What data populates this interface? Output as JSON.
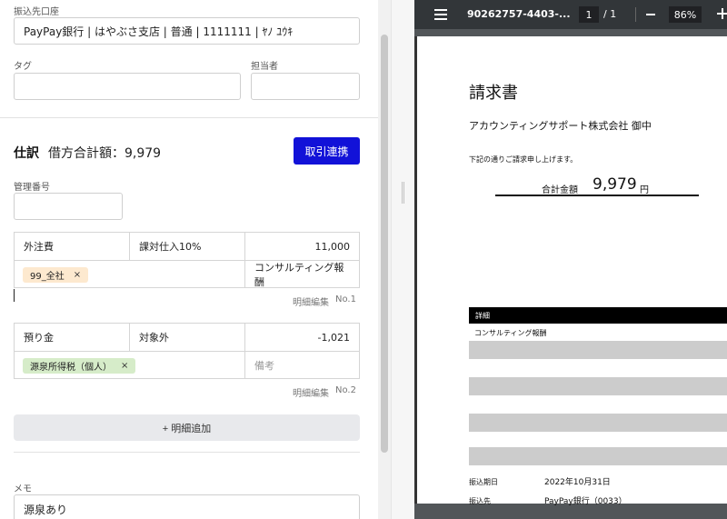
{
  "form": {
    "bank_account_label": "振込先口座",
    "bank_account_value": "PayPay銀行 | はやぶさ支店 | 普通 | 1111111 | ﾔﾉ ﾕｳｷ",
    "tag_label": "タグ",
    "tag_value": "",
    "assignee_label": "担当者",
    "assignee_value": ""
  },
  "journal": {
    "title": "仕訳",
    "debit_total": "借方合計額：9,979",
    "link_button": "取引連携",
    "control_no_label": "管理番号",
    "control_no_value": "",
    "lines": [
      {
        "account": "外注費",
        "tax": "課対仕入10%",
        "amount": "11,000",
        "tag": "99_全社",
        "tag_remove": "×",
        "memo": "コンサルティング報酬",
        "edit_label": "明細編集",
        "line_no": "No.1"
      },
      {
        "account": "預り金",
        "tax": "対象外",
        "amount": "-1,021",
        "tag": "源泉所得税（個人）",
        "tag_remove": "×",
        "memo": "",
        "memo_placeholder": "備考",
        "edit_label": "明細編集",
        "line_no": "No.2"
      }
    ],
    "add_line_button": "+ 明細追加"
  },
  "memo": {
    "label": "メモ",
    "value": "源泉あり"
  },
  "pdf_viewer": {
    "file_name": "90262757-4403-...",
    "current_page": "1",
    "page_total": "/ 1",
    "zoom": "86%",
    "document": {
      "title": "請求書",
      "client": "アカウンティングサポート株式会社 御中",
      "greeting": "下記の通りご請求申し上げます。",
      "total_label": "合計金額",
      "total_value": "9,979",
      "total_unit": "円",
      "detail_header": "詳細",
      "detail_item": "コンサルティング報酬",
      "transfer_date_label": "振込期日",
      "transfer_date_value": "2022年10月31日",
      "transfer_to_label": "振込先",
      "transfer_to_value": "PayPay銀行（0033）"
    }
  },
  "colors": {
    "primary": "#1212d8",
    "tag_orange_bg": "#fde9cf",
    "tag_green_bg": "#d6ecc9",
    "viewer_bg": "#525659",
    "toolbar_bg": "#323639"
  }
}
